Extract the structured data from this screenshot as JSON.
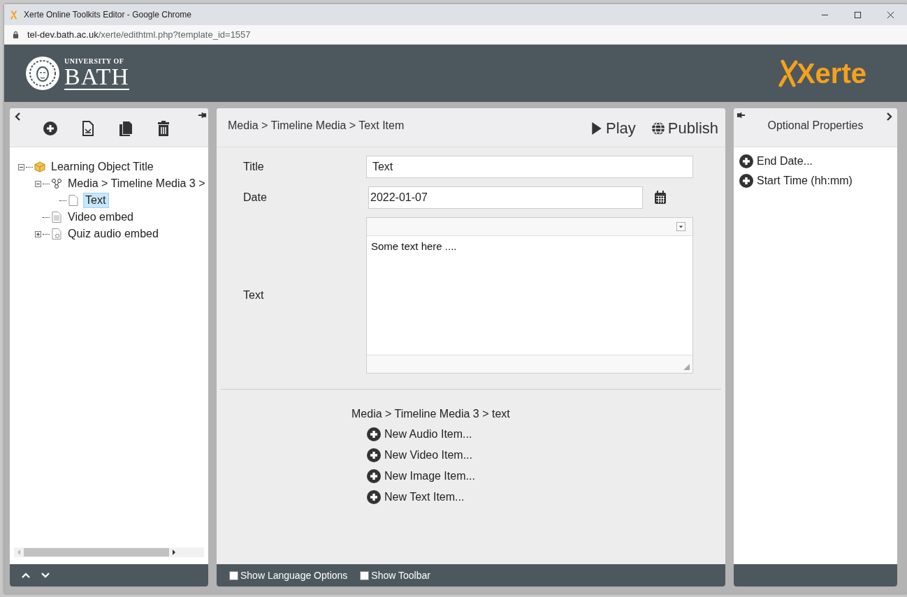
{
  "window": {
    "title": "Xerte Online Toolkits Editor - Google Chrome"
  },
  "address": {
    "host": "tel-dev.bath.ac.uk",
    "path": "/xerte/edithtml.php?template_id=1557"
  },
  "header": {
    "logo_top": "UNIVERSITY OF",
    "logo_main": "BATH",
    "brand": "Xerte"
  },
  "left": {
    "tree": [
      {
        "label": "Learning Object Title",
        "kind": "project",
        "expanded": true,
        "selected": false,
        "children": [
          {
            "label": "Media > Timeline Media 3 >",
            "kind": "group",
            "expanded": true,
            "selected": false,
            "children": [
              {
                "label": "Text",
                "kind": "page",
                "selected": true
              }
            ]
          },
          {
            "label": "Video embed",
            "kind": "document",
            "selected": false
          },
          {
            "label": "Quiz audio embed",
            "kind": "settings-document",
            "expanded": false,
            "selected": false
          }
        ]
      }
    ]
  },
  "center": {
    "breadcrumb": "Media > Timeline Media > Text Item",
    "actions": [
      {
        "label": "Play",
        "kind": "play"
      },
      {
        "label": "Publish",
        "kind": "globe"
      }
    ],
    "fields": [
      {
        "label": "Title",
        "kind": "text",
        "value": "Text"
      },
      {
        "label": "Date",
        "kind": "date",
        "value": "2022-01-07"
      },
      {
        "label": "Text",
        "kind": "editor",
        "value": "Some text here ...."
      }
    ],
    "add_path": "Media > Timeline Media 3 > text",
    "add_items": [
      "New Audio Item...",
      "New Video Item...",
      "New Image Item...",
      "New Text Item..."
    ],
    "footer": [
      {
        "label": "Show Language Options",
        "checked": false
      },
      {
        "label": "Show Toolbar",
        "checked": false
      }
    ]
  },
  "right": {
    "title": "Optional Properties",
    "items": [
      "End Date...",
      "Start Time (hh:mm)"
    ]
  }
}
